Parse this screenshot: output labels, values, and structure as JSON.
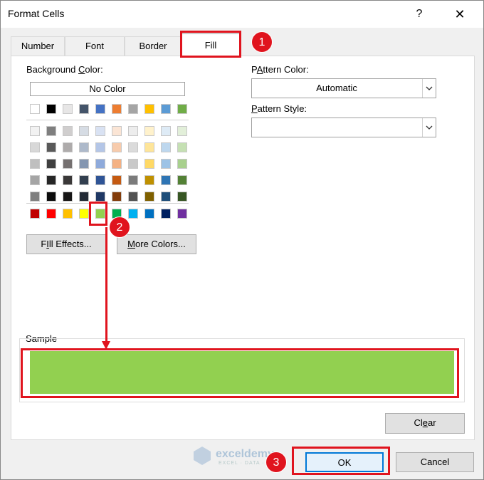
{
  "window": {
    "title": "Format Cells",
    "help": "?",
    "close": "✕"
  },
  "tabs": [
    {
      "label": "Number"
    },
    {
      "label": "Font"
    },
    {
      "label": "Border"
    },
    {
      "label": "Fill"
    }
  ],
  "fill": {
    "background_color_label_pre": "Background ",
    "background_color_label_key": "C",
    "background_color_label_post": "olor:",
    "no_color": "No Color",
    "fill_effects_key": "I",
    "fill_effects_pre": "F",
    "fill_effects_post": "ll Effects...",
    "more_colors_key": "M",
    "more_colors_post": "ore Colors...",
    "pattern_color_key": "A",
    "pattern_color_pre": "P",
    "pattern_color_post": "ttern Color:",
    "pattern_color_value": "Automatic",
    "pattern_style_key": "P",
    "pattern_style_post": "attern Style:",
    "pattern_style_value": "",
    "sample_label": "Sample",
    "sample_color": "#92d050"
  },
  "palette": {
    "theme_row": [
      "#ffffff",
      "#000000",
      "#e7e6e6",
      "#44546a",
      "#4472c4",
      "#ed7d31",
      "#a5a5a5",
      "#ffc000",
      "#5b9bd5",
      "#70ad47"
    ],
    "tint_rows": [
      [
        "#f2f2f2",
        "#7f7f7f",
        "#d0cece",
        "#d6dce4",
        "#d9e2f3",
        "#fbe5d5",
        "#ededed",
        "#fff2cc",
        "#deebf6",
        "#e2efd9"
      ],
      [
        "#d8d8d8",
        "#595959",
        "#aeabab",
        "#adb9ca",
        "#b4c6e7",
        "#f7cbac",
        "#dbdbdb",
        "#fee599",
        "#bdd7ee",
        "#c5e0b3"
      ],
      [
        "#bfbfbf",
        "#3f3f3f",
        "#757070",
        "#8496b0",
        "#8eaadb",
        "#f4b183",
        "#c9c9c9",
        "#ffd965",
        "#9dc3e6",
        "#a8d08d"
      ],
      [
        "#a5a5a5",
        "#262626",
        "#3a3838",
        "#323f4f",
        "#2f5496",
        "#c55a11",
        "#7b7b7b",
        "#bf9000",
        "#2e75b5",
        "#538135"
      ],
      [
        "#7f7f7f",
        "#0c0c0c",
        "#171616",
        "#222a35",
        "#1f3864",
        "#833c0b",
        "#525252",
        "#7f6000",
        "#1e4e79",
        "#375623"
      ]
    ],
    "standard_row": [
      "#c00000",
      "#ff0000",
      "#ffc000",
      "#ffff00",
      "#92d050",
      "#00b050",
      "#00b0f0",
      "#0070c0",
      "#002060",
      "#7030a0"
    ]
  },
  "buttons": {
    "clear_key": "e",
    "clear_pre": "Cl",
    "clear_post": "ar",
    "ok": "OK",
    "cancel": "Cancel"
  },
  "annotations": [
    "1",
    "2",
    "3"
  ],
  "watermark": {
    "name": "exceldemy",
    "tagline": "EXCEL · DATA · BI"
  }
}
